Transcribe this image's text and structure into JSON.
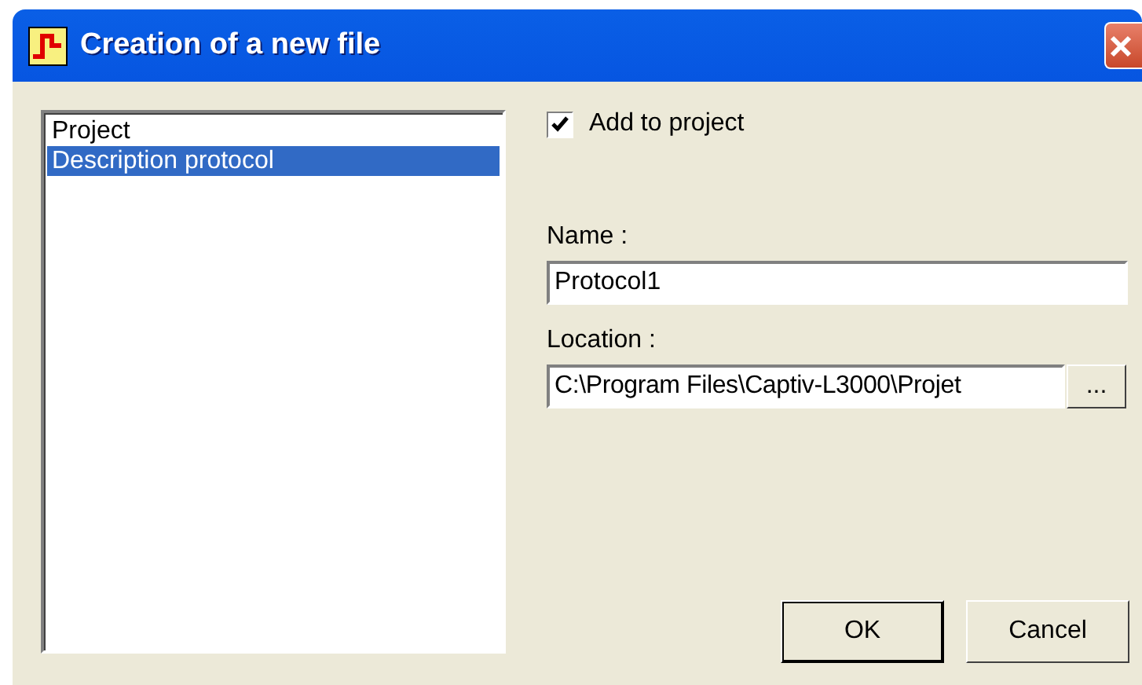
{
  "window": {
    "title": "Creation of a new file"
  },
  "list": [
    {
      "label": "Project",
      "selected": false
    },
    {
      "label": "Description protocol",
      "selected": true
    }
  ],
  "add_to_project": {
    "label": "Add to project",
    "checked": true
  },
  "name": {
    "label": "Name :",
    "value": "Protocol1"
  },
  "location": {
    "label": "Location :",
    "value": "C:\\Program Files\\Captiv-L3000\\Projet",
    "browse": "..."
  },
  "buttons": [
    {
      "label": "OK",
      "default": true
    },
    {
      "label": "Cancel",
      "default": false
    }
  ]
}
